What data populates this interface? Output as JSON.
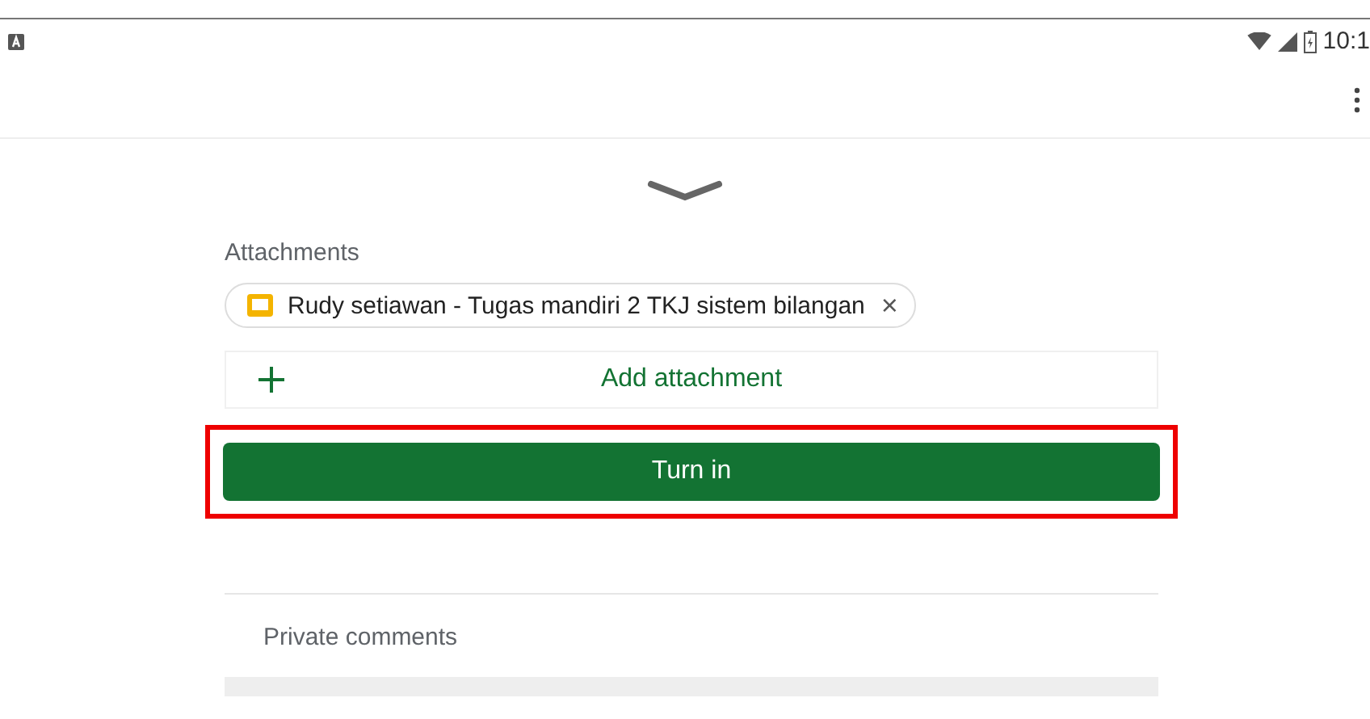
{
  "status_bar": {
    "time": "10:1"
  },
  "attachments": {
    "heading": "Attachments",
    "files": [
      {
        "name": "Rudy setiawan - Tugas mandiri 2 TKJ sistem bilangan",
        "remove": "×"
      }
    ],
    "add_label": "Add attachment"
  },
  "turn_in": {
    "label": "Turn in",
    "highlighted": true
  },
  "private_comments": {
    "heading": "Private comments"
  }
}
